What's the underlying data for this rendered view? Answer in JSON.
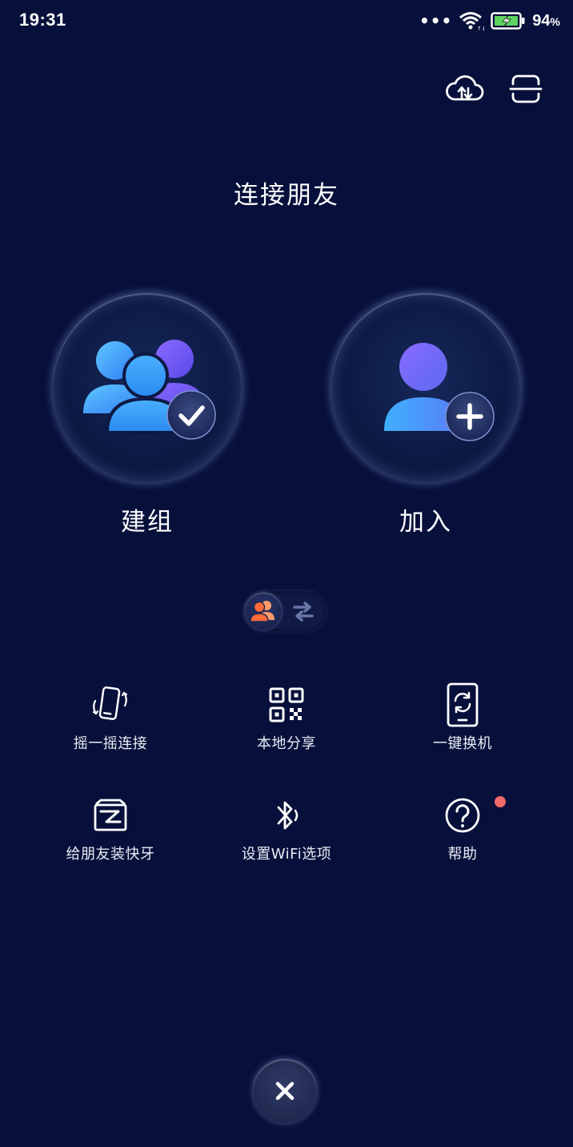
{
  "status_bar": {
    "time": "19:31",
    "dots": "•••",
    "battery_percent": "94",
    "battery_unit": "%"
  },
  "header": {
    "title": "连接朋友"
  },
  "actions": {
    "create_group_label": "建组",
    "join_label": "加入"
  },
  "tools": [
    {
      "label": "摇一摇连接",
      "icon": "shake-phone-icon"
    },
    {
      "label": "本地分享",
      "icon": "qr-code-icon"
    },
    {
      "label": "一键换机",
      "icon": "phone-switch-icon"
    },
    {
      "label": "给朋友装快牙",
      "icon": "install-box-icon"
    },
    {
      "label": "设置WiFi选项",
      "icon": "bluetooth-icon"
    },
    {
      "label": "帮助",
      "icon": "help-icon"
    }
  ],
  "colors": {
    "background": "#07103a",
    "accent_blue": "#3aa8ff",
    "accent_purple": "#7a5cff",
    "badge_red": "#f06a6a",
    "toggle_orange": "#ff7a4a"
  }
}
